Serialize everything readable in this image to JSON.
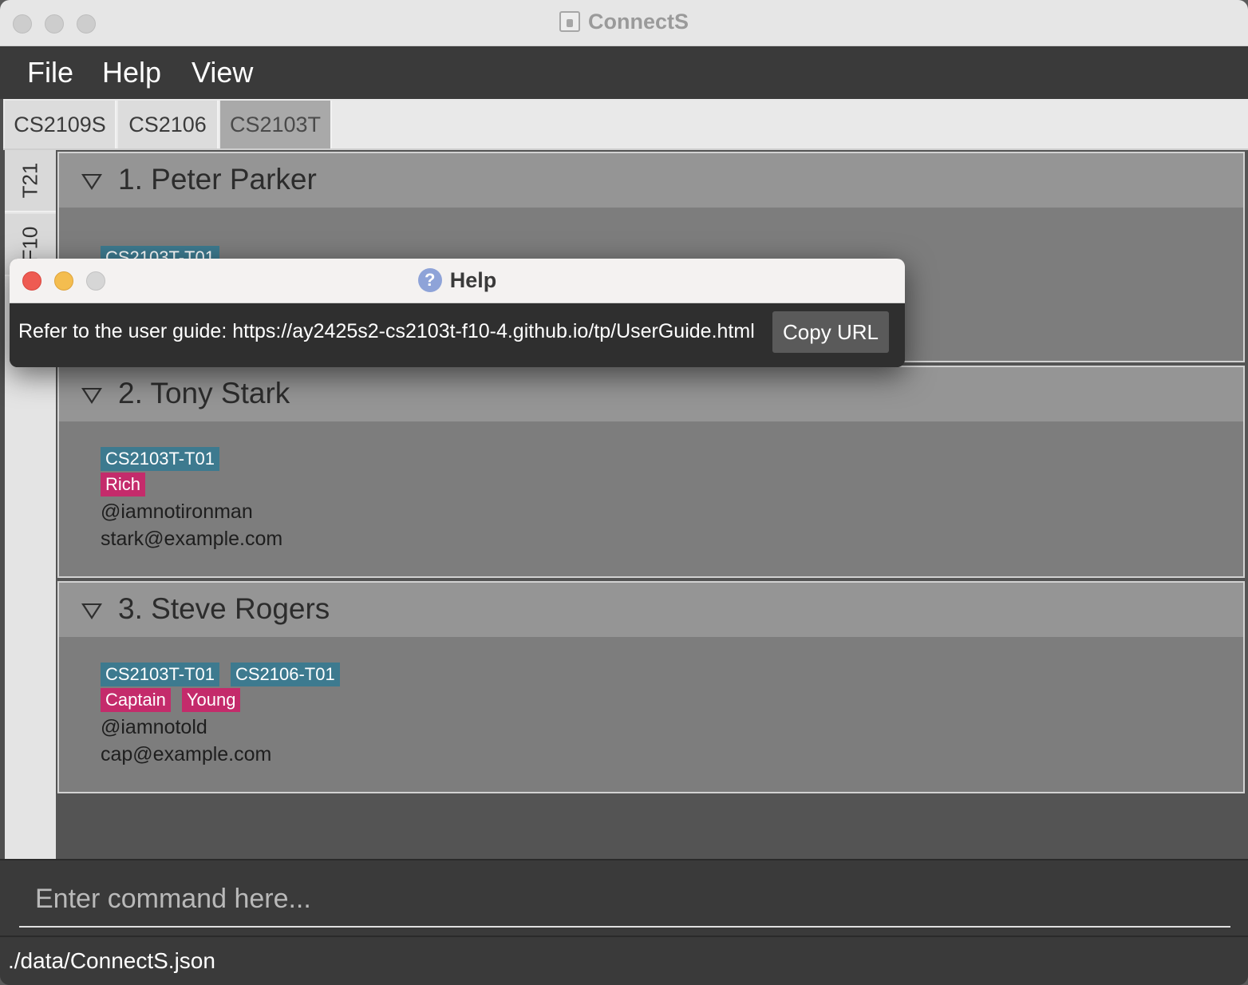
{
  "window": {
    "title": "ConnectS"
  },
  "menu": [
    "File",
    "Help",
    "View"
  ],
  "module_tabs": [
    {
      "label": "CS2109S",
      "active": false
    },
    {
      "label": "CS2106",
      "active": false
    },
    {
      "label": "CS2103T",
      "active": true
    }
  ],
  "tutorial_tabs": [
    "T21",
    "F10"
  ],
  "persons": [
    {
      "title": "1. Peter Parker",
      "module_tags": [
        "CS2103T-T01"
      ],
      "remark_tags": [],
      "handle": "",
      "email": ""
    },
    {
      "title": "2. Tony Stark",
      "module_tags": [
        "CS2103T-T01"
      ],
      "remark_tags": [
        "Rich"
      ],
      "handle": "@iamnotironman",
      "email": "stark@example.com"
    },
    {
      "title": "3. Steve Rogers",
      "module_tags": [
        "CS2103T-T01",
        "CS2106-T01"
      ],
      "remark_tags": [
        "Captain",
        "Young"
      ],
      "handle": "@iamnotold",
      "email": "cap@example.com"
    }
  ],
  "command": {
    "placeholder": "Enter command here...",
    "value": ""
  },
  "status": {
    "path": "./data/ConnectS.json"
  },
  "help_dialog": {
    "title": "Help",
    "message": "Refer to the user guide: https://ay2425s2-cs2103t-f10-4.github.io/tp/UserGuide.html",
    "copy_button": "Copy URL"
  },
  "colors": {
    "module_tag": "#3d7a8f",
    "remark_tag": "#c42b6b",
    "close": "#ee5b52",
    "minimize": "#f4bd4f"
  }
}
